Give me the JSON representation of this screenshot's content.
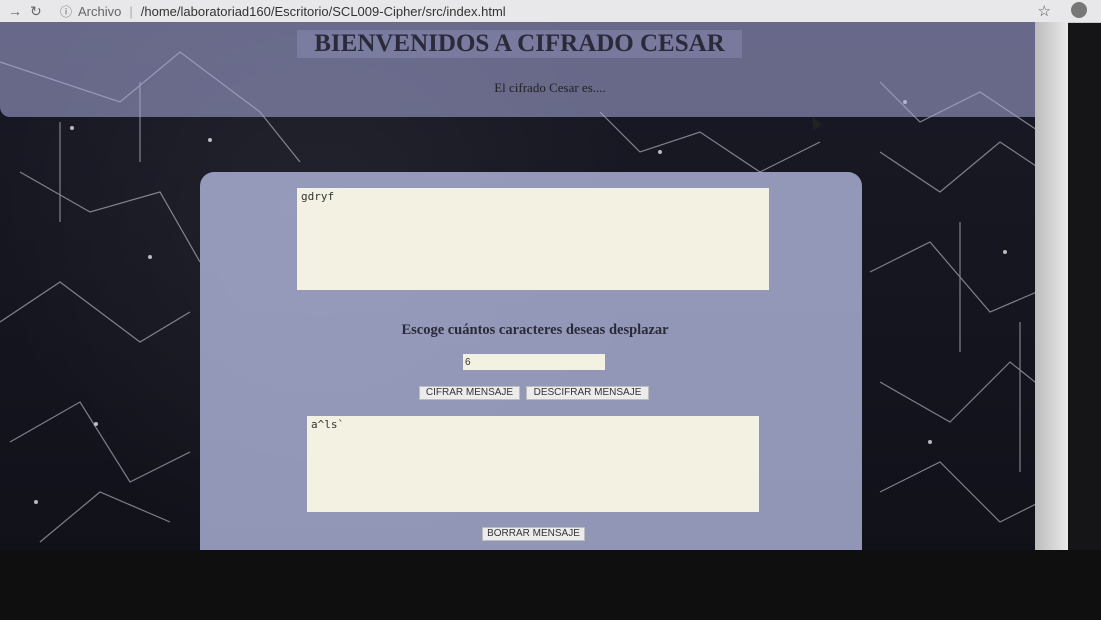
{
  "browser": {
    "back_icon": "arrow-right-icon",
    "reload_icon": "reload-icon",
    "info_icon": "info-icon",
    "origin_label": "Archivo",
    "url": "/home/laboratoriad160/Escritorio/SCL009-Cipher/src/index.html",
    "bookmark_icon": "star-icon"
  },
  "header": {
    "title": "BIENVENIDOS A CIFRADO CESAR",
    "subtitle": "El cifrado Cesar es...."
  },
  "cipher": {
    "message_value": "gdryf",
    "shift_label": "Escoge cuántos caracteres deseas desplazar",
    "shift_value": "6",
    "encrypt_label": "CIFRAR MENSAJE",
    "decrypt_label": "DESCIFRAR MENSAJE",
    "result_value": "a^ls`",
    "clear_label": "BORRAR MENSAJE"
  },
  "colors": {
    "panel": "#b4b8e4",
    "textarea_bg": "#f3f2e2",
    "background": "#151517"
  }
}
